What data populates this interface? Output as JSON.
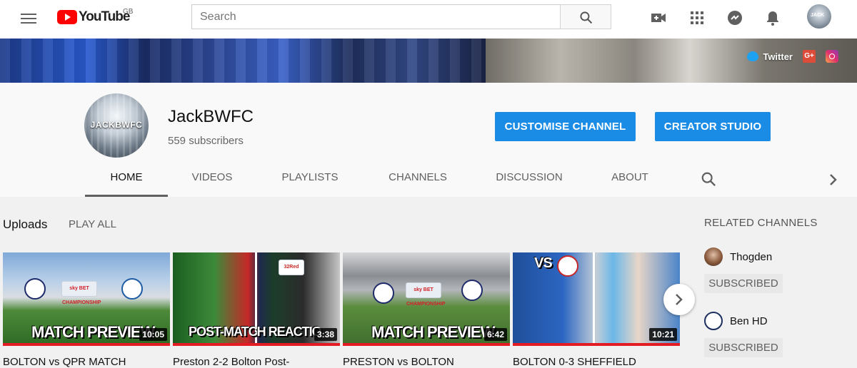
{
  "masthead": {
    "logo_text": "YouTube",
    "region": "GB",
    "search_placeholder": "Search",
    "icons": [
      "menu-icon",
      "search-icon",
      "create-video-icon",
      "apps-icon",
      "messages-icon",
      "notifications-icon",
      "account-avatar"
    ]
  },
  "banner": {
    "links": [
      {
        "label": "Twitter",
        "icon": "twitter-icon"
      },
      {
        "label": "G+",
        "icon": "google-plus-icon"
      },
      {
        "label": "",
        "icon": "instagram-icon"
      }
    ]
  },
  "channel": {
    "avatar_text": "JACKBWFC",
    "name": "JackBWFC",
    "subscribers": "559 subscribers",
    "buttons": {
      "customise": "CUSTOMISE CHANNEL",
      "studio": "CREATOR STUDIO"
    },
    "accent_color": "#1b8ce6"
  },
  "tabs": [
    {
      "label": "HOME",
      "active": true
    },
    {
      "label": "VIDEOS",
      "active": false
    },
    {
      "label": "PLAYLISTS",
      "active": false
    },
    {
      "label": "CHANNELS",
      "active": false
    },
    {
      "label": "DISCUSSION",
      "active": false
    },
    {
      "label": "ABOUT",
      "active": false
    }
  ],
  "uploads": {
    "title": "Uploads",
    "play_all": "PLAY ALL",
    "videos": [
      {
        "thumb_text": "MATCH PREVIEW",
        "duration": "10:05",
        "title": "BOLTON vs QPR MATCH"
      },
      {
        "thumb_text": "POST-MATCH REACTIO",
        "duration": "3:38",
        "title": "Preston 2-2 Bolton Post-"
      },
      {
        "thumb_text": "MATCH PREVIEW",
        "duration": "6:42",
        "title": "PRESTON vs BOLTON"
      },
      {
        "thumb_text": "VS",
        "duration": "10:21",
        "title": "BOLTON 0-3 SHEFFIELD"
      }
    ],
    "thumb_badges": {
      "sky1": "sky BET CHAMPIONSHIP",
      "sky3": "sky BET CHAMPIONSHIP",
      "sign": "32Red"
    }
  },
  "related": {
    "title": "RELATED CHANNELS",
    "channels": [
      {
        "name": "Thogden",
        "button": "SUBSCRIBED"
      },
      {
        "name": "Ben HD",
        "button": "SUBSCRIBED"
      }
    ]
  }
}
